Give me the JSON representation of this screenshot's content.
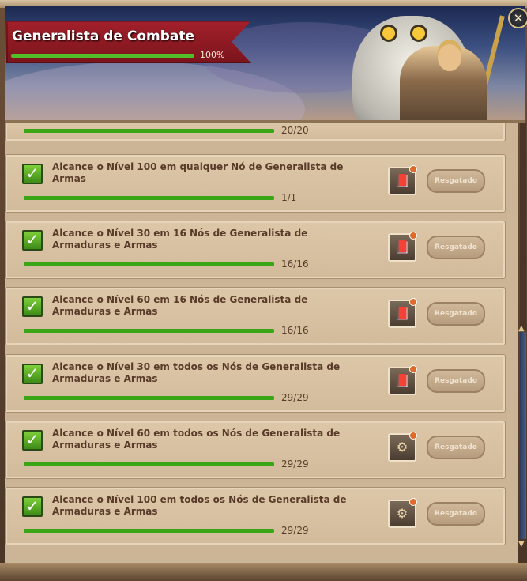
{
  "header": {
    "title": "Generalista de Combate",
    "progress_label": "100%",
    "progress": 1.0,
    "close_icon": "close-icon"
  },
  "achievements": [
    {
      "description": "",
      "count": "20/20",
      "progress": 1.0,
      "partial": true
    },
    {
      "description": "Alcance o Nível 100 em qualquer Nó de Generalista de Armas",
      "count": "1/1",
      "progress": 1.0,
      "button": "Resgatado",
      "reward_icon": "book-icon"
    },
    {
      "description": "Alcance o Nível 30 em 16 Nós de Generalista de Armaduras e Armas",
      "count": "16/16",
      "progress": 1.0,
      "button": "Resgatado",
      "reward_icon": "book-icon"
    },
    {
      "description": "Alcance o Nível 60 em 16 Nós de Generalista de Armaduras e Armas",
      "count": "16/16",
      "progress": 1.0,
      "button": "Resgatado",
      "reward_icon": "book-icon"
    },
    {
      "description": "Alcance o Nível 30 em todos os Nós de Generalista de Armaduras e Armas",
      "count": "29/29",
      "progress": 1.0,
      "button": "Resgatado",
      "reward_icon": "book-icon"
    },
    {
      "description": "Alcance o Nível 60 em todos os Nós de Generalista de Armaduras e Armas",
      "count": "29/29",
      "progress": 1.0,
      "button": "Resgatado",
      "reward_icon": "mount-icon"
    },
    {
      "description": "Alcance o Nível 100 em todos os Nós de Generalista de Armaduras e Armas",
      "count": "29/29",
      "progress": 1.0,
      "button": "Resgatado",
      "reward_icon": "mount-icon"
    }
  ]
}
